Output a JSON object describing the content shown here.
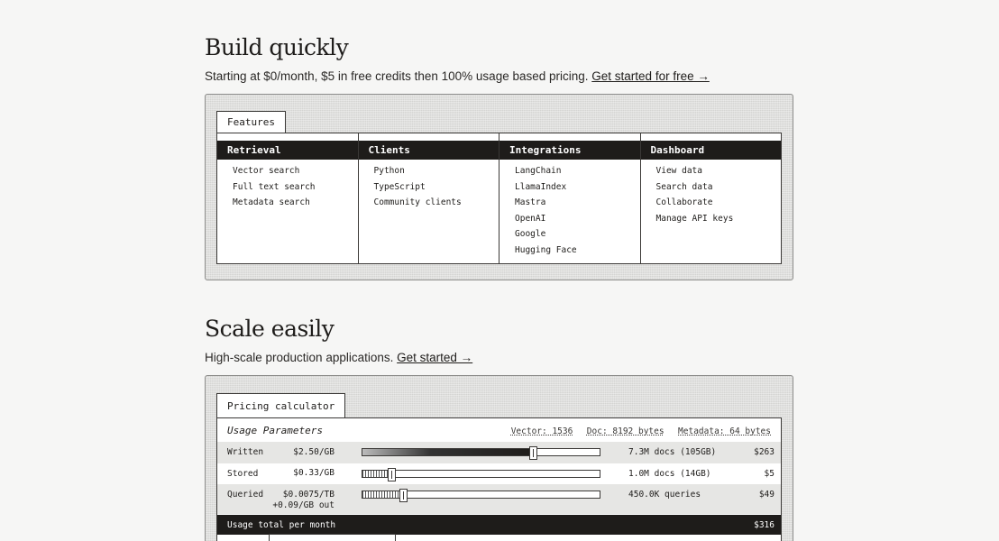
{
  "build": {
    "heading": "Build quickly",
    "subtitle": "Starting at $0/month, $5 in free credits then 100% usage based pricing.",
    "link": "Get started for free →",
    "tab": "Features",
    "columns": [
      {
        "title": "Retrieval",
        "items": [
          "Vector search",
          "Full text search",
          "Metadata search"
        ]
      },
      {
        "title": "Clients",
        "items": [
          "Python",
          "TypeScript",
          "Community clients"
        ]
      },
      {
        "title": "Integrations",
        "items": [
          "LangChain",
          "LlamaIndex",
          "Mastra",
          "OpenAI",
          "Google",
          "Hugging Face"
        ]
      },
      {
        "title": "Dashboard",
        "items": [
          "View data",
          "Search data",
          "Collaborate",
          "Manage API keys"
        ]
      }
    ]
  },
  "scale": {
    "heading": "Scale easily",
    "subtitle": "High-scale production applications.",
    "link": "Get started →",
    "tab": "Pricing calculator",
    "usage_title": "Usage Parameters",
    "meta": [
      "Vector: 1536",
      "Doc: 8192 bytes",
      "Metadata: 64 bytes"
    ],
    "rows": [
      {
        "label": "Written",
        "price": "$2.50/GB",
        "price2": "",
        "quantity": "7.3M docs (105GB)",
        "cost": "$263",
        "level": 0.72
      },
      {
        "label": "Stored",
        "price": "$0.33/GB",
        "price2": "",
        "quantity": "1.0M docs (14GB)",
        "cost": "$5",
        "level": 0.12
      },
      {
        "label": "Queried",
        "price": "$0.0075/TB",
        "price2": "+0.09/GB out",
        "quantity": "450.0K queries",
        "cost": "$49",
        "level": 0.17
      }
    ],
    "total_label": "Usage total per month",
    "total_value": "$316"
  }
}
